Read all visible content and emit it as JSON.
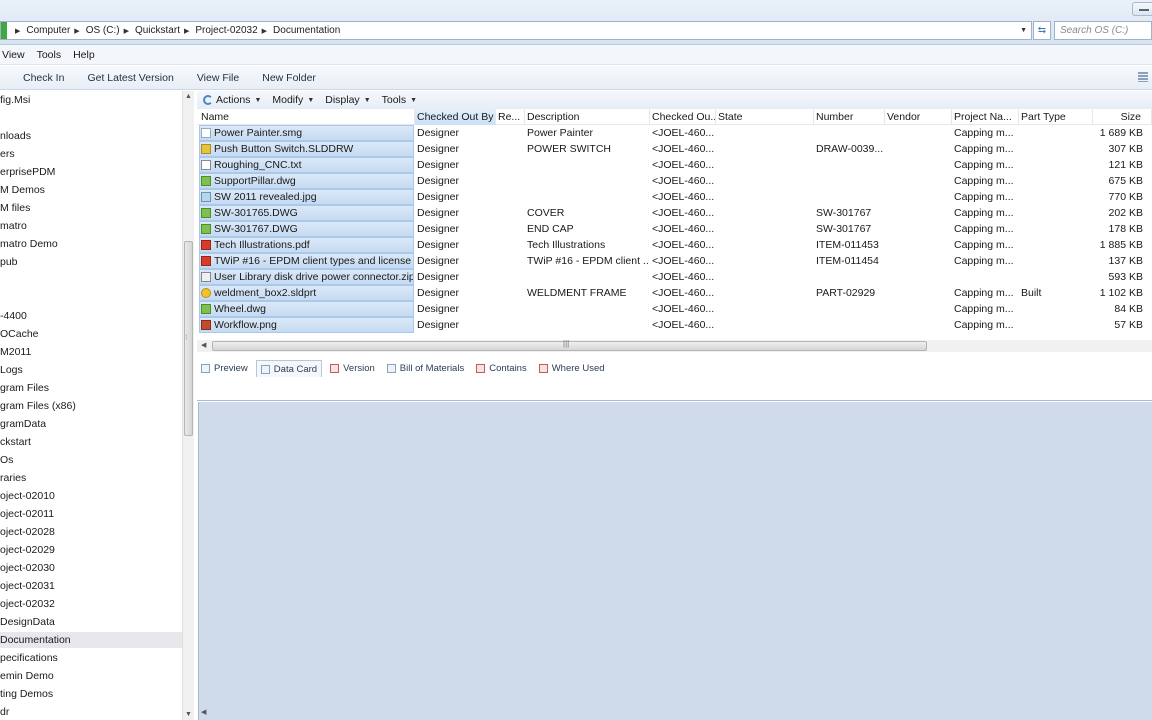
{
  "address_bar": {
    "crumbs": [
      "Computer",
      "OS (C:)",
      "Quickstart",
      "Project-02032",
      "Documentation"
    ],
    "search_placeholder": "Search OS (C:)"
  },
  "menu": [
    "View",
    "Tools",
    "Help"
  ],
  "toolbar": [
    "Check In",
    "Get Latest Version",
    "View File",
    "New Folder"
  ],
  "tree": {
    "items": [
      "fig.Msi",
      "",
      "nloads",
      "ers",
      "erprisePDM",
      "M Demos",
      "M files",
      "matro",
      "matro Demo",
      "pub",
      "",
      "",
      "-4400",
      "OCache",
      "M2011",
      "Logs",
      "gram Files",
      "gram Files (x86)",
      "gramData",
      "ckstart",
      "Os",
      "raries",
      "oject-02010",
      "oject-02011",
      "oject-02028",
      "oject-02029",
      "oject-02030",
      "oject-02031",
      "oject-02032",
      "DesignData",
      "Documentation",
      "pecifications",
      "emin Demo",
      "ting Demos",
      "dr"
    ],
    "selected_index": 30
  },
  "commands": [
    "Actions",
    "Modify",
    "Display",
    "Tools"
  ],
  "columns": [
    "Name",
    "Checked Out By",
    "Re...",
    "Description",
    "Checked Ou...",
    "State",
    "Number",
    "Vendor",
    "Project Na...",
    "Part Type",
    "Size"
  ],
  "rows": [
    {
      "icon": "smg",
      "name": "Power Painter.smg",
      "checked_out_by": "Designer",
      "description": "Power Painter",
      "checked_out_in": "<JOEL-460...",
      "number": "",
      "project": "Capping m...",
      "part_type": "",
      "size": "1 689 KB"
    },
    {
      "icon": "drw",
      "name": "Push Button Switch.SLDDRW",
      "checked_out_by": "Designer",
      "description": "POWER SWITCH",
      "checked_out_in": "<JOEL-460...",
      "number": "DRAW-0039...",
      "project": "Capping m...",
      "part_type": "",
      "size": "307 KB"
    },
    {
      "icon": "txt",
      "name": "Roughing_CNC.txt",
      "checked_out_by": "Designer",
      "description": "",
      "checked_out_in": "<JOEL-460...",
      "number": "",
      "project": "Capping m...",
      "part_type": "",
      "size": "121 KB"
    },
    {
      "icon": "dwg",
      "name": "SupportPillar.dwg",
      "checked_out_by": "Designer",
      "description": "",
      "checked_out_in": "<JOEL-460...",
      "number": "",
      "project": "Capping m...",
      "part_type": "",
      "size": "675 KB"
    },
    {
      "icon": "jpg",
      "name": "SW 2011 revealed.jpg",
      "checked_out_by": "Designer",
      "description": "",
      "checked_out_in": "<JOEL-460...",
      "number": "",
      "project": "Capping m...",
      "part_type": "",
      "size": "770 KB"
    },
    {
      "icon": "dwg",
      "name": "SW-301765.DWG",
      "checked_out_by": "Designer",
      "description": "COVER",
      "checked_out_in": "<JOEL-460...",
      "number": "SW-301767",
      "project": "Capping m...",
      "part_type": "",
      "size": "202 KB"
    },
    {
      "icon": "dwg",
      "name": "SW-301767.DWG",
      "checked_out_by": "Designer",
      "description": "END CAP",
      "checked_out_in": "<JOEL-460...",
      "number": "SW-301767",
      "project": "Capping m...",
      "part_type": "",
      "size": "178 KB"
    },
    {
      "icon": "pdf",
      "name": "Tech Illustrations.pdf",
      "checked_out_by": "Designer",
      "description": "Tech Illustrations",
      "checked_out_in": "<JOEL-460...",
      "number": "ITEM-011453",
      "project": "Capping m...",
      "part_type": "",
      "size": "1 885 KB"
    },
    {
      "icon": "pdf",
      "name": "TWiP #16 - EPDM client types and license p...",
      "checked_out_by": "Designer",
      "description": "TWiP #16 - EPDM client ...",
      "checked_out_in": "<JOEL-460...",
      "number": "ITEM-011454",
      "project": "Capping m...",
      "part_type": "",
      "size": "137 KB"
    },
    {
      "icon": "zip",
      "name": "User Library disk drive power connector.zip",
      "checked_out_by": "Designer",
      "description": "",
      "checked_out_in": "<JOEL-460...",
      "number": "",
      "project": "",
      "part_type": "",
      "size": "593 KB"
    },
    {
      "icon": "prt",
      "name": "weldment_box2.sldprt",
      "checked_out_by": "Designer",
      "description": "WELDMENT FRAME",
      "checked_out_in": "<JOEL-460...",
      "number": "PART-02929",
      "project": "Capping m...",
      "part_type": "Built",
      "size": "1 102 KB"
    },
    {
      "icon": "dwg",
      "name": "Wheel.dwg",
      "checked_out_by": "Designer",
      "description": "",
      "checked_out_in": "<JOEL-460...",
      "number": "",
      "project": "Capping m...",
      "part_type": "",
      "size": "84 KB"
    },
    {
      "icon": "wf",
      "name": "Workflow.png",
      "checked_out_by": "Designer",
      "description": "",
      "checked_out_in": "<JOEL-460...",
      "number": "",
      "project": "Capping m...",
      "part_type": "",
      "size": "57 KB"
    }
  ],
  "tabs": [
    {
      "label": "Preview",
      "icon": "preview-icon"
    },
    {
      "label": "Data Card",
      "icon": "data-card-icon",
      "active": true
    },
    {
      "label": "Version",
      "icon": "version-icon"
    },
    {
      "label": "Bill of Materials",
      "icon": "bom-icon"
    },
    {
      "label": "Contains",
      "icon": "contains-icon"
    },
    {
      "label": "Where Used",
      "icon": "where-used-icon"
    }
  ],
  "colors": {
    "selection": "#c5daf1",
    "detail_bg": "#cfdbea",
    "header_highlight": "#c9e1f6"
  }
}
